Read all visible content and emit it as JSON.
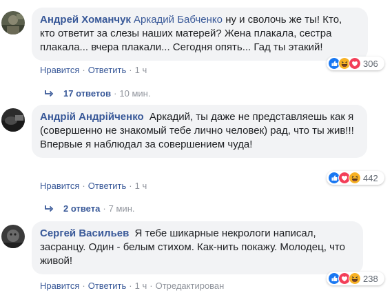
{
  "comments": [
    {
      "author": "Андрей Хоманчук",
      "mention": "Аркадий Бабченко",
      "text": "ну и сволочь же ты! Кто, кто ответит за слезы наших матерей? Жена плакала, сестра плакала... вчера плакали... Сегодня опять... Гад ты этакий!",
      "like_label": "Нравится",
      "reply_label": "Ответить",
      "time": "1 ч",
      "edited": "",
      "reaction_count": "306",
      "reaction_icons": [
        "like-icon",
        "haha-icon",
        "love-icon"
      ]
    },
    {
      "author": "Андрій Андрійченко",
      "mention": "",
      "text": "Аркадий, ты даже не представляешь как я (совершенно не знакомый тебе лично человек) рад, что ты жив!!!",
      "text2": "Впервые я наблюдал за совершением чуда!",
      "like_label": "Нравится",
      "reply_label": "Ответить",
      "time": "1 ч",
      "edited": "",
      "reaction_count": "442",
      "reaction_icons": [
        "like-icon",
        "love-icon",
        "haha-icon"
      ]
    },
    {
      "author": "Сергей Васильев",
      "mention": "",
      "text": "Я тебе шикарные некрологи написал, засранцу. Один - белым стихом. Как-нить покажу. Молодец, что живой!",
      "like_label": "Нравится",
      "reply_label": "Ответить",
      "time": "1 ч",
      "edited": "Отредактирован",
      "reaction_count": "238",
      "reaction_icons": [
        "like-icon",
        "love-icon",
        "haha-icon"
      ]
    }
  ],
  "replies": [
    {
      "label": "17 ответов",
      "time": "10 мин."
    },
    {
      "label": "2 ответа",
      "time": "7 мин."
    }
  ],
  "colors": {
    "link": "#385898",
    "bubble": "#f2f3f5",
    "meta": "#90949c",
    "like": "#1877f2",
    "love": "#f33e58",
    "haha": "#f7b125"
  }
}
